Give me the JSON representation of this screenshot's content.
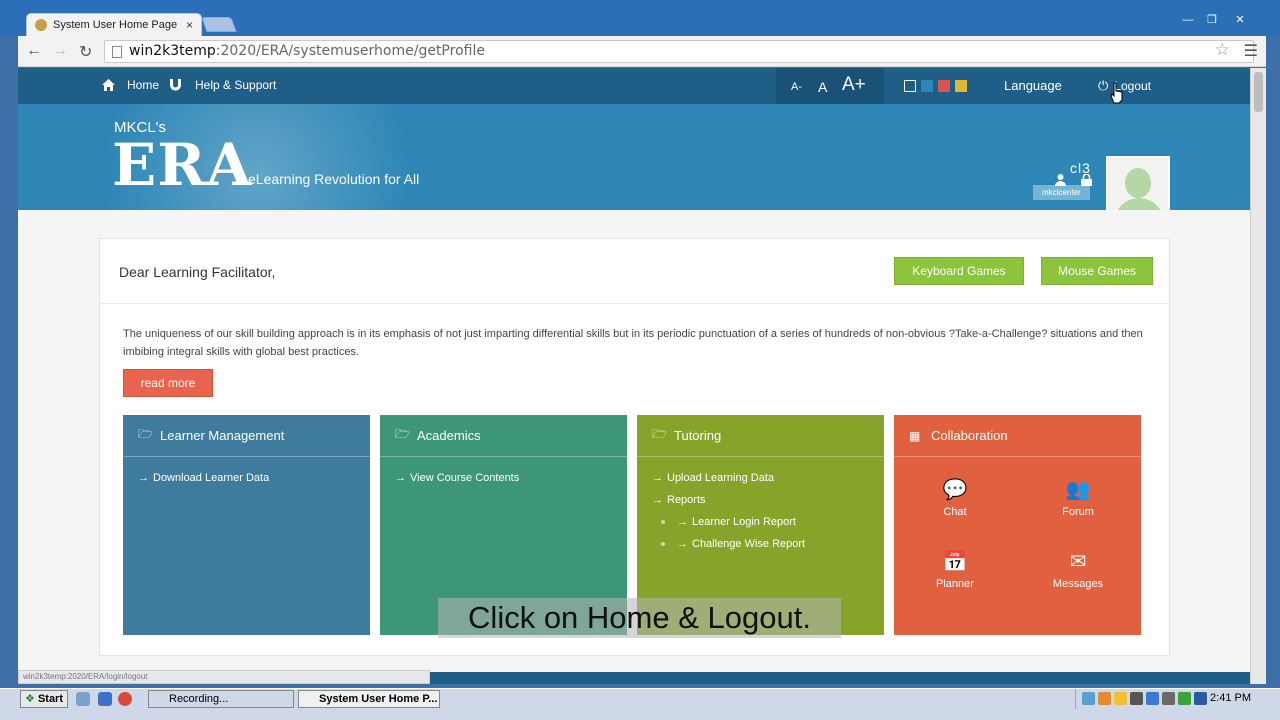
{
  "browser": {
    "tab_title": "System User Home Page",
    "tab_close": "×",
    "url_host": "win2k3temp",
    "url_path": ":2020/ERA/systemuserhome/getProfile",
    "status_url": "win2k3temp:2020/ERA/login/logout"
  },
  "topnav": {
    "home_label": "Home",
    "help_label": "Help & Support",
    "font_small": "A-",
    "font_normal": "A",
    "font_large": "A+",
    "swatch_colors": [
      "#ffffff",
      "#2d86b6",
      "#d9534f",
      "#e0b733"
    ],
    "language_label": "Language",
    "logout_label": "Logout"
  },
  "header": {
    "brand_prefix": "MKCL's",
    "brand_name": "ERA",
    "tagline": "eLearning Revolution for All",
    "user_name": "cl3",
    "user_center": "mkclcenter"
  },
  "card": {
    "greeting": "Dear Learning Facilitator,",
    "keyboard_games": "Keyboard Games",
    "mouse_games": "Mouse Games",
    "intro": "The uniqueness of our skill building approach is in its emphasis of not just imparting differential skills but in its periodic punctuation of a series of hundreds of non-obvious ?Take-a-Challenge? situations and then imbibing integral skills with global best practices.",
    "read_more": "read more"
  },
  "panels": {
    "learner": {
      "title": "Learner Management",
      "color": "#3f7b9c",
      "items": [
        "Download Learner Data"
      ]
    },
    "academics": {
      "title": "Academics",
      "color": "#3d9777",
      "items": [
        "View Course Contents"
      ]
    },
    "tutoring": {
      "title": "Tutoring",
      "color": "#86a42a",
      "items": [
        "Upload Learning Data",
        "Reports"
      ],
      "sub_items": [
        "Learner Login Report",
        "Challenge Wise Report"
      ]
    },
    "collaboration": {
      "title": "Collaboration",
      "color": "#e0603f",
      "items": [
        "Chat",
        "Forum",
        "Planner",
        "Messages"
      ]
    }
  },
  "caption": "Click on Home & Logout.",
  "taskbar": {
    "start": "Start",
    "task_recording": "Recording...",
    "task_browser": "System User Home P...",
    "clock": "2:41 PM"
  }
}
